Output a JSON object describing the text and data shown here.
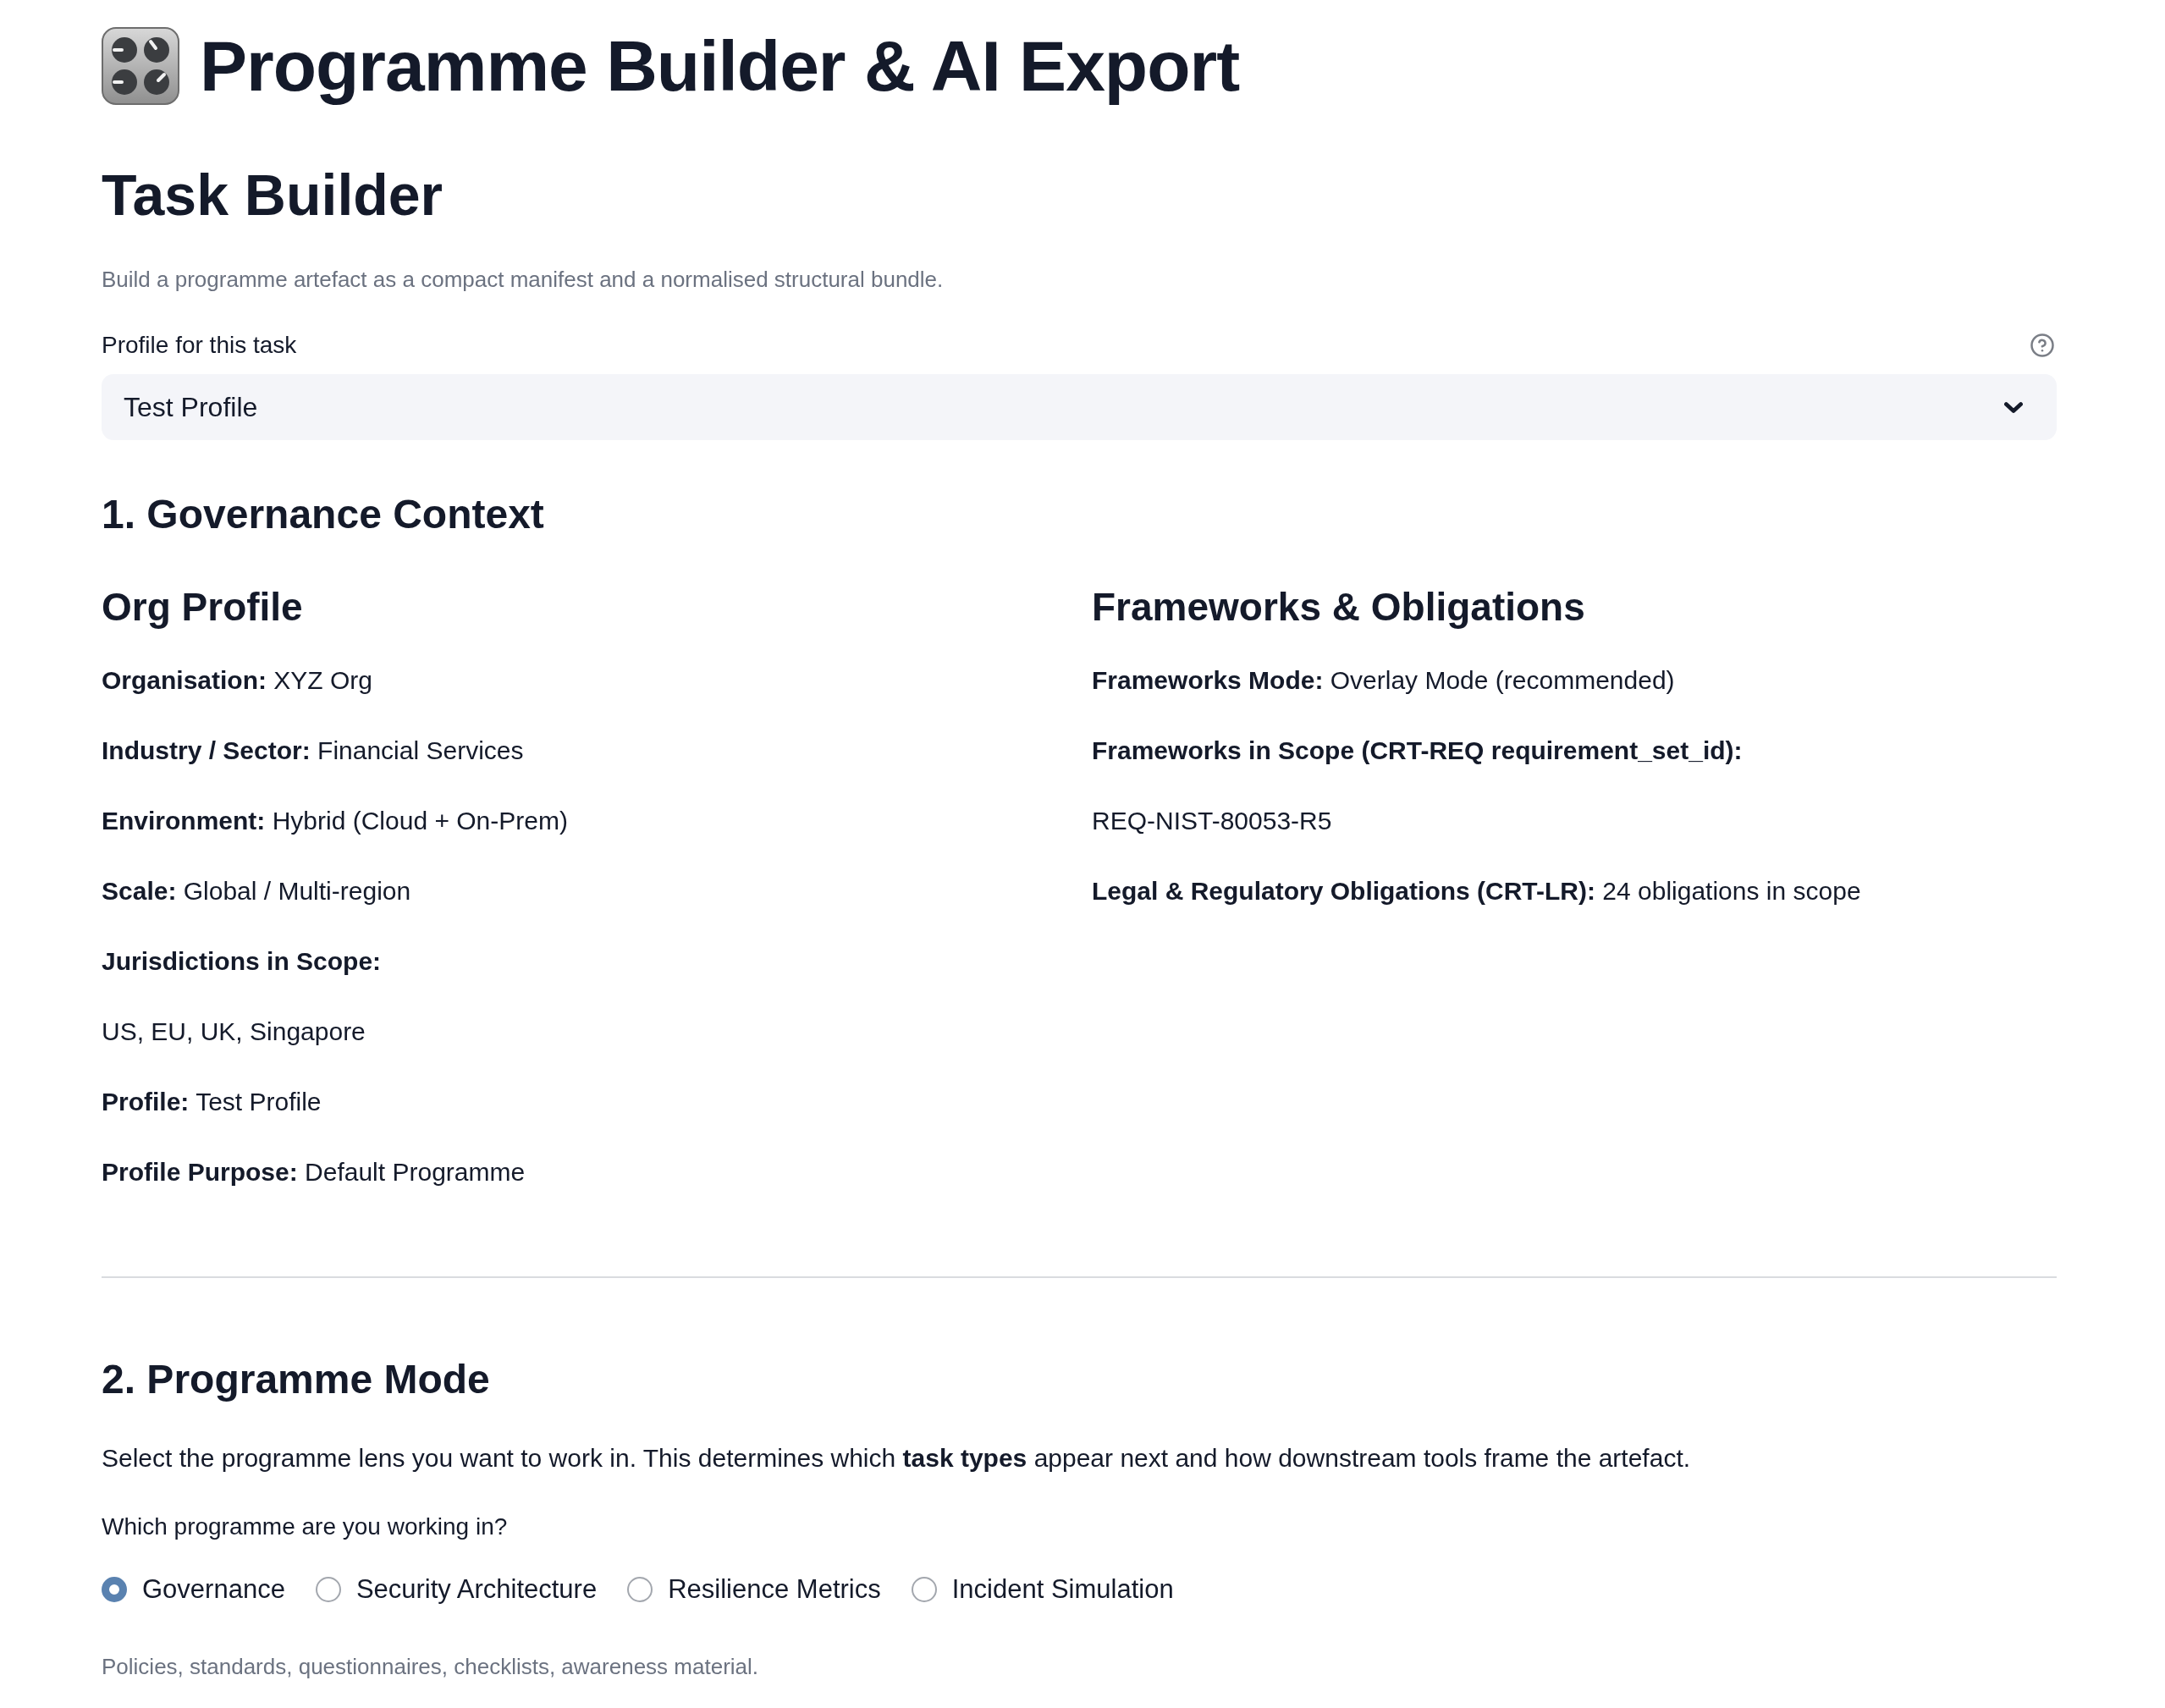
{
  "header": {
    "title": "Programme Builder & AI Export"
  },
  "task_builder": {
    "heading": "Task Builder",
    "description": "Build a programme artefact as a compact manifest and a normalised structural bundle.",
    "profile_select": {
      "label": "Profile for this task",
      "value": "Test Profile"
    }
  },
  "governance_context": {
    "heading": "1. Governance Context",
    "columns": [
      {
        "heading": "Org Profile",
        "items": [
          {
            "kind": "field",
            "label": "Organisation:",
            "value": "XYZ Org"
          },
          {
            "kind": "field",
            "label": "Industry / Sector:",
            "value": "Financial Services"
          },
          {
            "kind": "field",
            "label": "Environment:",
            "value": "Hybrid (Cloud + On-Prem)"
          },
          {
            "kind": "field",
            "label": "Scale:",
            "value": "Global / Multi-region"
          },
          {
            "kind": "label",
            "label": "Jurisdictions in Scope:"
          },
          {
            "kind": "value",
            "value": "US, EU, UK, Singapore"
          },
          {
            "kind": "field",
            "label": "Profile:",
            "value": "Test Profile"
          },
          {
            "kind": "field",
            "label": "Profile Purpose:",
            "value": "Default Programme"
          }
        ]
      },
      {
        "heading": "Frameworks & Obligations",
        "items": [
          {
            "kind": "field",
            "label": "Frameworks Mode:",
            "value": "Overlay Mode (recommended)"
          },
          {
            "kind": "label",
            "label": "Frameworks in Scope (CRT-REQ requirement_set_id):"
          },
          {
            "kind": "value",
            "value": "REQ-NIST-80053-R5"
          },
          {
            "kind": "field",
            "label": "Legal & Regulatory Obligations (CRT-LR):",
            "value": "24 obligations in scope"
          }
        ]
      }
    ]
  },
  "programme_mode": {
    "heading": "2. Programme Mode",
    "intro": "Select the programme lens you want to work in. This determines which **task types** appear next and how downstream tools frame the artefact.",
    "question": "Which programme are you working in?",
    "options": [
      {
        "label": "Governance",
        "selected": true
      },
      {
        "label": "Security Architecture",
        "selected": false
      },
      {
        "label": "Resilience Metrics",
        "selected": false
      },
      {
        "label": "Incident Simulation",
        "selected": false
      }
    ],
    "caption": "Policies, standards, questionnaires, checklists, awareness material."
  }
}
